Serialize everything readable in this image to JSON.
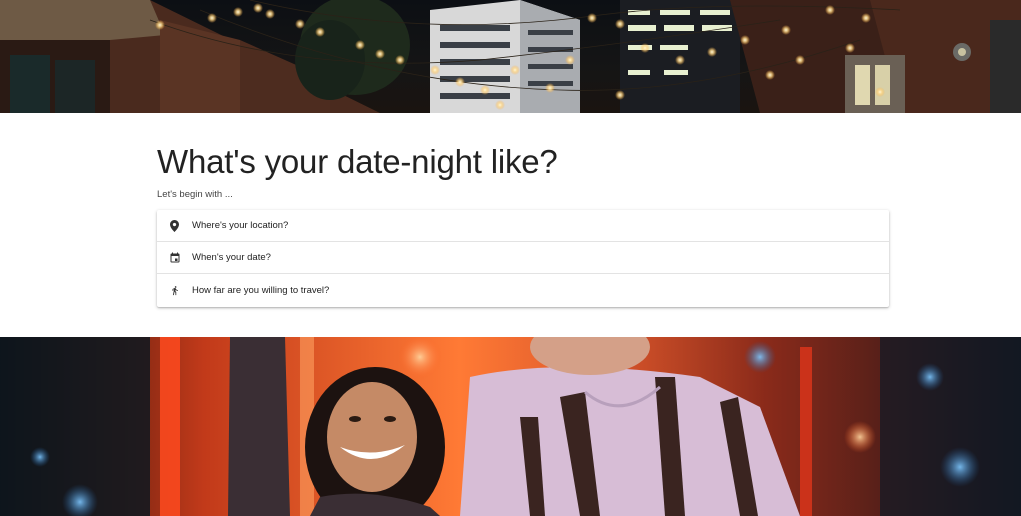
{
  "hero_top": {
    "image": "night-street-string-lights"
  },
  "main": {
    "title": "What's your date-night like?",
    "subtitle": "Let's begin with ...",
    "options": [
      {
        "icon": "location-pin-icon",
        "label": "Where's your location?"
      },
      {
        "icon": "calendar-icon",
        "label": "When's your date?"
      },
      {
        "icon": "walking-icon",
        "label": "How far are you willing to travel?"
      }
    ]
  },
  "hero_bottom": {
    "image": "couple-neon-lights"
  },
  "colors": {
    "title_text": "#222222",
    "card_border": "#e3e3e3",
    "icon": "#333333"
  }
}
